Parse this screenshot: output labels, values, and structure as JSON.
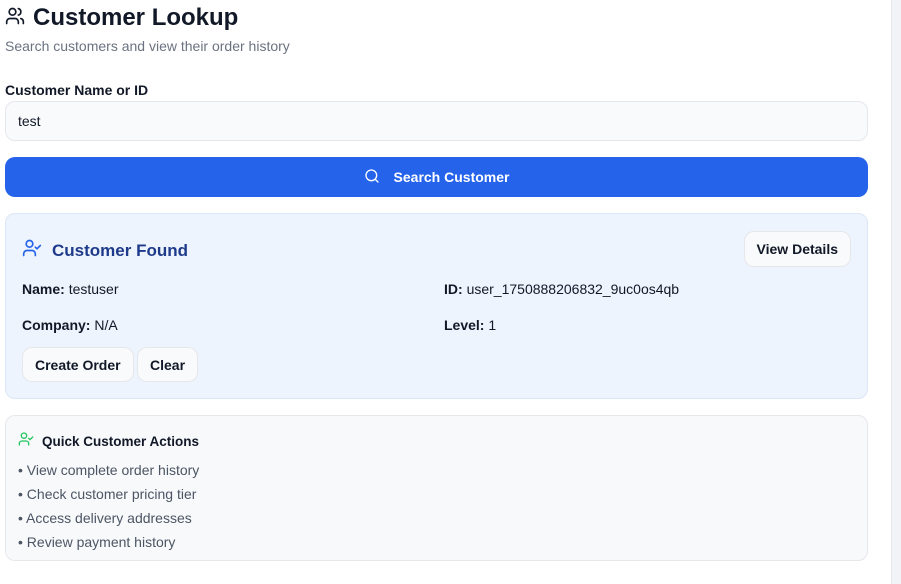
{
  "header": {
    "title": "Customer Lookup",
    "subtitle": "Search customers and view their order history"
  },
  "search": {
    "label": "Customer Name or ID",
    "value": "test",
    "button_label": "Search Customer"
  },
  "result": {
    "title": "Customer Found",
    "view_details_label": "View Details",
    "name_label": "Name:",
    "name_value": "testuser",
    "id_label": "ID:",
    "id_value": "user_1750888206832_9uc0os4qb",
    "company_label": "Company:",
    "company_value": "N/A",
    "level_label": "Level:",
    "level_value": "1",
    "create_order_label": "Create Order",
    "clear_label": "Clear"
  },
  "quick_actions": {
    "title": "Quick Customer Actions",
    "items": [
      "• View complete order history",
      "• Check customer pricing tier",
      "• Access delivery addresses",
      "• Review payment history"
    ]
  },
  "colors": {
    "primary": "#2563eb",
    "found_bg": "#eef4fd",
    "found_title": "#1e3a8a",
    "success_icon": "#22c55e"
  },
  "icons": {
    "header": "users-icon",
    "search": "search-icon",
    "found": "user-check-icon",
    "quick": "user-check-icon"
  }
}
